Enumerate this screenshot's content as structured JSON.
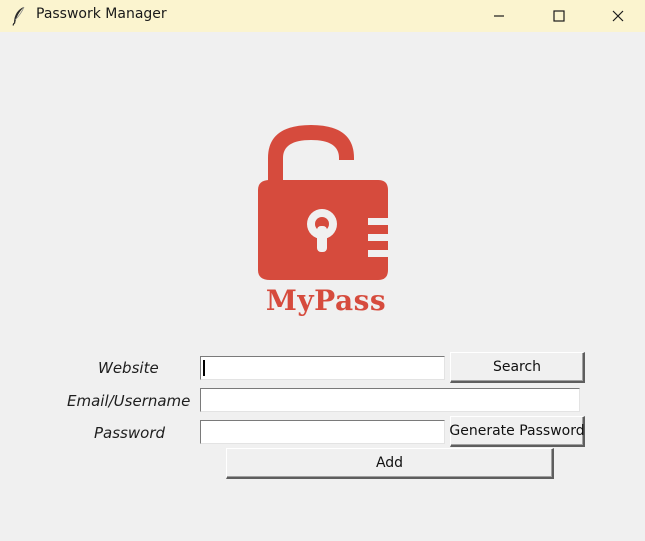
{
  "window": {
    "title": "Passwork Manager",
    "app_icon": "feather-icon",
    "controls": [
      "minimize-icon",
      "maximize-icon",
      "close-icon"
    ]
  },
  "logo": {
    "icon": "open-padlock-icon",
    "text": "MyPass",
    "color": "#d64b3d"
  },
  "form": {
    "website_label": "Website",
    "website_value": "",
    "email_label": "Email/Username",
    "email_value": "",
    "password_label": "Password",
    "password_value": ""
  },
  "buttons": {
    "search": "Search",
    "generate": "Generate Password",
    "add": "Add"
  }
}
